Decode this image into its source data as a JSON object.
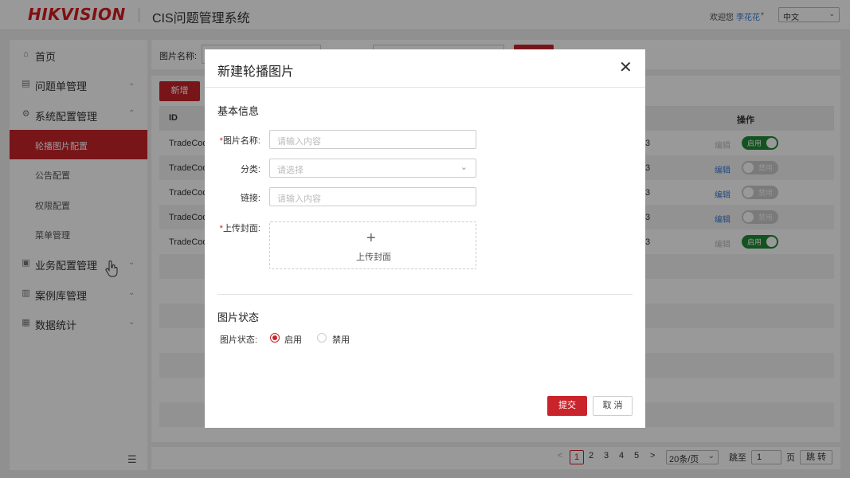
{
  "header": {
    "logo": "HIKVISION",
    "system_title": "CIS问题管理系统",
    "welcome": "欢迎您",
    "user_name": "李花花",
    "language": "中文"
  },
  "sidebar": {
    "items": [
      {
        "label": "首页",
        "icon": "home-icon"
      },
      {
        "label": "问题单管理",
        "icon": "document-icon"
      },
      {
        "label": "系统配置管理",
        "icon": "settings-icon"
      },
      {
        "label": "业务配置管理",
        "icon": "briefcase-icon"
      },
      {
        "label": "案例库管理",
        "icon": "book-icon"
      },
      {
        "label": "数据统计",
        "icon": "chart-icon"
      }
    ],
    "sub_items": [
      {
        "label": "轮播图片配置",
        "active": true
      },
      {
        "label": "公告配置",
        "active": false
      },
      {
        "label": "权限配置",
        "active": false
      },
      {
        "label": "菜单管理",
        "active": false
      }
    ]
  },
  "search": {
    "label": "图片名称:"
  },
  "table": {
    "add_label": "新增",
    "col_id": "ID",
    "col_op": "操作",
    "edit_label": "编辑",
    "enable_label": "启用",
    "disable_label": "禁用",
    "rows": [
      {
        "id": "TradeCod",
        "extra": "3",
        "enabled": true
      },
      {
        "id": "TradeCod",
        "extra": "3",
        "enabled": false
      },
      {
        "id": "TradeCod",
        "extra": "3",
        "enabled": false
      },
      {
        "id": "TradeCod",
        "extra": "3",
        "enabled": false
      },
      {
        "id": "TradeCod",
        "extra": "3",
        "enabled": true
      }
    ]
  },
  "pager": {
    "prev": "<",
    "next": ">",
    "pages": [
      "1",
      "2",
      "3",
      "4",
      "5"
    ],
    "current": "1",
    "page_size": "20条/页",
    "jump_label": "跳至",
    "jump_value": "1",
    "page_unit": "页",
    "go_label": "跳 转"
  },
  "modal": {
    "title": "新建轮播图片",
    "section_basic": "基本信息",
    "name_label": "图片名称:",
    "name_placeholder": "请输入内容",
    "category_label": "分类:",
    "category_placeholder": "请选择",
    "link_label": "链接:",
    "link_placeholder": "请输入内容",
    "cover_label": "上传封面:",
    "upload_text": "上传封面",
    "section_status": "图片状态",
    "status_label": "图片状态:",
    "status_options": [
      "启用",
      "禁用"
    ],
    "status_selected": "启用",
    "submit_label": "提交",
    "cancel_label": "取 消"
  },
  "colors": {
    "brand": "#c9232b",
    "link": "#3a7bd5",
    "toggle_on": "#1e8a36"
  }
}
